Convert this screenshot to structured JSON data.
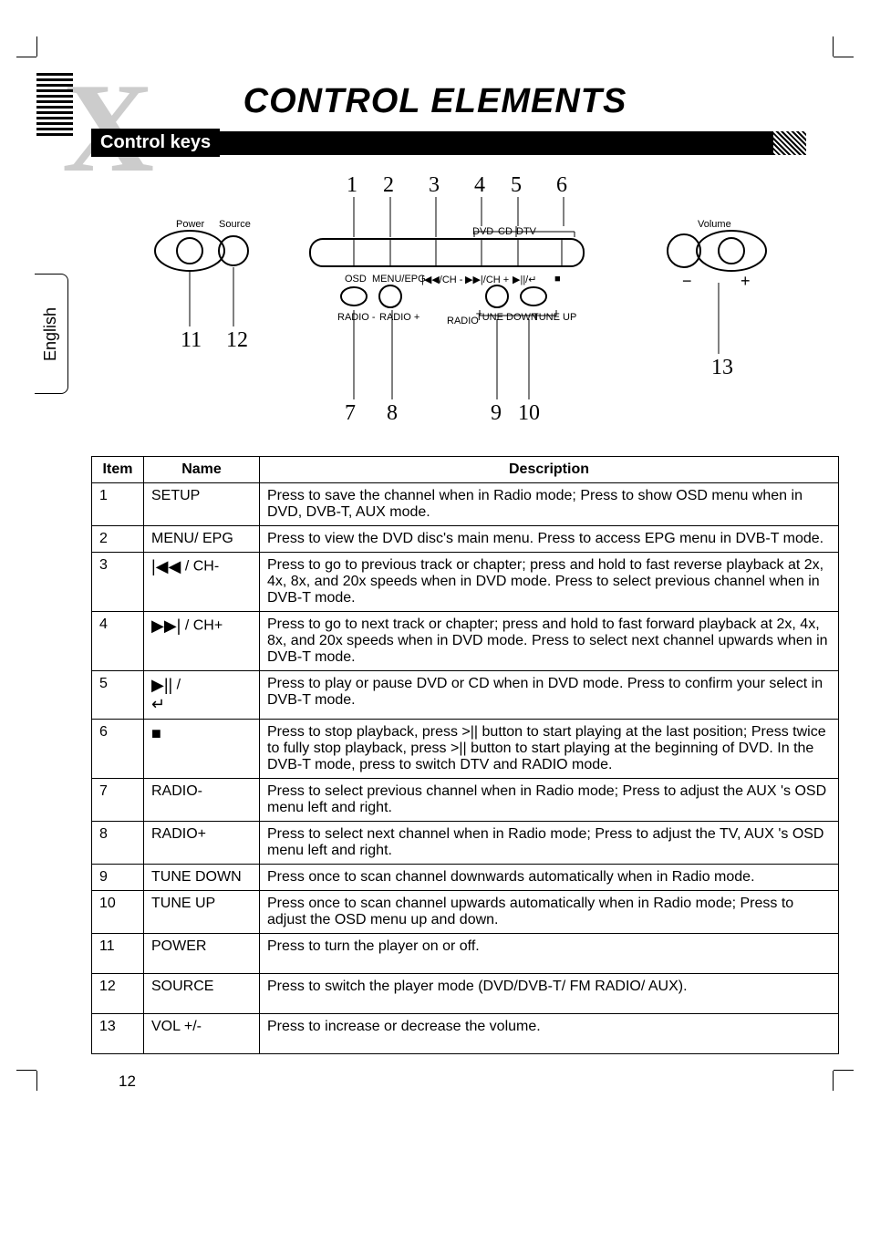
{
  "title": "CONTROL ELEMENTS",
  "section": "Control keys",
  "side_tab": "English",
  "page_number": "12",
  "diagram": {
    "top_numbers": [
      "1",
      "2",
      "3",
      "4",
      "5",
      "6"
    ],
    "bottom_numbers": [
      "7",
      "8",
      "9",
      "10"
    ],
    "left_numbers": [
      "11",
      "12"
    ],
    "right_number": "13",
    "labels": {
      "power": "Power",
      "source": "Source",
      "volume": "Volume",
      "dvd": "DVD",
      "cd": "CD",
      "dtv": "DTV",
      "osd": "OSD",
      "menu_epg": "MENU/EPG",
      "prev_ch": "|◀◀/CH -",
      "next_ch": "▶▶|/CH +",
      "play_enter": "▶||/↵",
      "stop": "■",
      "radio_minus": "RADIO -",
      "radio_plus": "RADIO +",
      "radio": "RADIO",
      "tune_down": "TUNE DOWN",
      "tune_up": "TUNE UP",
      "vol_minus": "−",
      "vol_plus": "+"
    }
  },
  "table": {
    "headers": {
      "item": "Item",
      "name": "Name",
      "desc": "Description"
    },
    "rows": [
      {
        "item": "1",
        "name": "SETUP",
        "desc": "Press to save the channel when in Radio mode; Press to show OSD menu when in DVD, DVB-T, AUX mode."
      },
      {
        "item": "2",
        "name": "MENU/ EPG",
        "desc": "Press to view the DVD disc's main menu. Press to access EPG menu in DVB-T mode."
      },
      {
        "item": "3",
        "name_icon": "prev",
        "name_suffix": " / CH-",
        "desc": "Press to go to previous track or chapter; press and hold to fast reverse playback at 2x, 4x, 8x, and 20x speeds when in DVD mode. Press to select previous channel when in DVB-T mode."
      },
      {
        "item": "4",
        "name_icon": "next",
        "name_suffix": " / CH+",
        "desc": "Press to go to next track or chapter; press and hold to fast forward playback at 2x, 4x, 8x, and 20x speeds when in DVD mode. Press to select next channel upwards when in DVB-T mode."
      },
      {
        "item": "5",
        "name_icon": "play_enter",
        "name_suffix": "",
        "desc": "Press to play or pause DVD or CD when in DVD mode. Press to confirm your select in DVB-T mode."
      },
      {
        "item": "6",
        "name_icon": "stop",
        "name_suffix": "",
        "desc": "Press to stop playback, press >|| button to start playing at the last position; Press twice to fully stop playback, press >|| button to start playing at the beginning of DVD. In the DVB-T mode, press to switch DTV and RADIO mode."
      },
      {
        "item": "7",
        "name": "RADIO-",
        "desc": "Press to select previous channel when in Radio mode; Press to adjust the AUX 's OSD menu left and right."
      },
      {
        "item": "8",
        "name": "RADIO+",
        "desc": "Press to select next channel when in Radio mode; Press to adjust the TV, AUX 's OSD menu left and right."
      },
      {
        "item": "9",
        "name": "TUNE DOWN",
        "desc": "Press once to scan channel downwards automatically when in Radio mode."
      },
      {
        "item": "10",
        "name": "TUNE UP",
        "desc": "Press once to scan channel upwards automatically when in Radio mode; Press to adjust the OSD menu up and down."
      },
      {
        "item": "11",
        "name": "POWER",
        "desc": "Press to turn the player on or off."
      },
      {
        "item": "12",
        "name": "SOURCE",
        "desc": "Press to switch the player mode (DVD/DVB-T/ FM RADIO/ AUX)."
      },
      {
        "item": "13",
        "name": "VOL +/-",
        "desc": "Press to increase or decrease the volume."
      }
    ]
  },
  "icons": {
    "prev": "|◀◀",
    "next": "▶▶|",
    "play_pause": "▶||",
    "enter": "↵",
    "stop": "■"
  }
}
